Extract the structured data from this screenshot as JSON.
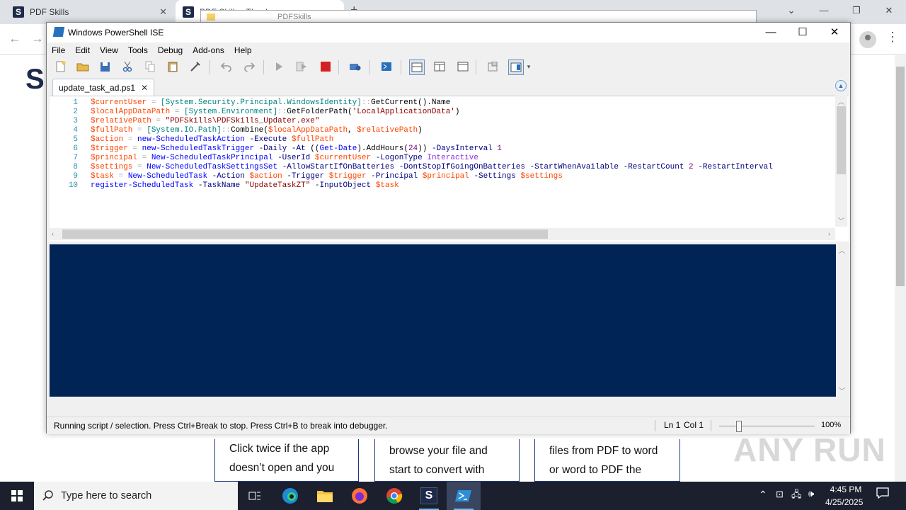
{
  "browser": {
    "tabs": [
      {
        "title": "PDF Skills"
      },
      {
        "title": "PDF Skills - Thank you"
      }
    ],
    "new_tab": "+",
    "window_controls": {
      "minimize": "—",
      "restore": "❐",
      "close": "✕",
      "menu": "⌄"
    },
    "page": {
      "logo": "S",
      "cards": [
        "Click twice if the app doesn’t open and you want to then Ideal",
        "browse your file and start to convert with",
        "files from PDF to word or word to PDF the"
      ],
      "watermark": "ANY RUN"
    }
  },
  "explorer_ghost": {
    "title": "PDFSkills"
  },
  "ise": {
    "title": "Windows PowerShell ISE",
    "window_controls": {
      "minimize": "—",
      "maximize": "☐",
      "close": "✕"
    },
    "menu": [
      "File",
      "Edit",
      "View",
      "Tools",
      "Debug",
      "Add-ons",
      "Help"
    ],
    "script_tab": {
      "name": "update_task_ad.ps1",
      "close": "✕"
    },
    "line_numbers": [
      "1",
      "2",
      "3",
      "4",
      "5",
      "6",
      "7",
      "8",
      "9",
      "10"
    ],
    "status": {
      "message": "Running script / selection.  Press Ctrl+Break to stop.  Press Ctrl+B to break into debugger.",
      "line": "Ln 1",
      "col": "Col 1",
      "zoom": "100%"
    },
    "colors": {
      "console_bg": "#012456",
      "variable": "#ff4500",
      "type": "#008080",
      "command": "#0000ff",
      "string": "#8b0000"
    }
  },
  "taskbar": {
    "search_placeholder": "Type here to search",
    "pinned": [
      "task-view-icon",
      "edge-icon",
      "file-explorer-icon",
      "firefox-icon",
      "chrome-icon",
      "pdfskills-icon",
      "powershell-ise-icon"
    ],
    "clock_time": "4:45 PM",
    "clock_date": "4/25/2025"
  }
}
